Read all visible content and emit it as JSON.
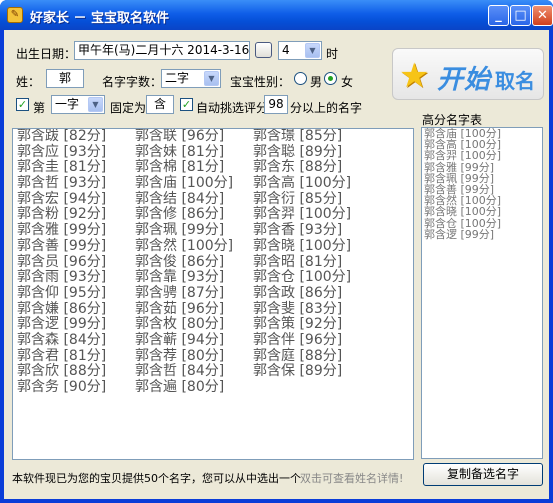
{
  "window": {
    "title": "好家长 － 宝宝取名软件"
  },
  "form": {
    "birth_label": "出生日期：",
    "birth_value": "甲午年(马)二月十六 2014-3-16",
    "hour_value": "4",
    "hour_unit": "时",
    "surname_label": "姓：",
    "surname_value": "郭",
    "name_length_label": "名字字数：",
    "name_length_value": "二字",
    "gender_label": "宝宝性别：",
    "gender_male": "男",
    "gender_female": "女",
    "position_prefix": "第",
    "position_value": "一字",
    "fixed_label": "固定为",
    "fixed_char": "含",
    "auto_label": "自动挑选评分",
    "score_value": "98",
    "score_suffix": "分以上的名字"
  },
  "start_button": {
    "main": "开始",
    "sub": "取名"
  },
  "name_columns": [
    [
      "郭含跋 [82分]",
      "郭含应 [93分]",
      "郭含圭 [81分]",
      "郭含哲 [93分]",
      "郭含宏 [94分]",
      "郭含粉 [92分]",
      "郭含雅 [99分]",
      "郭含善 [99分]",
      "郭含员 [96分]",
      "郭含雨 [93分]",
      "郭含仰 [95分]",
      "郭含嫌 [86分]",
      "郭含逻 [99分]",
      "郭含森 [84分]",
      "郭含君 [81分]",
      "郭含欣 [88分]",
      "郭含务 [90分]"
    ],
    [
      "郭含联 [96分]",
      "郭含妹 [81分]",
      "郭含棉 [81分]",
      "郭含庙 [100分]",
      "郭含结 [84分]",
      "郭含修 [86分]",
      "郭含珮 [99分]",
      "郭含然 [100分]",
      "郭含俊 [86分]",
      "郭含靠 [93分]",
      "郭含骋 [87分]",
      "郭含茹 [96分]",
      "郭含枚 [80分]",
      "郭含蕲 [94分]",
      "郭含荐 [80分]",
      "郭含哲 [84分]",
      "郭含遍 [80分]"
    ],
    [
      "郭含璟 [85分]",
      "郭含聪 [89分]",
      "郭含东 [88分]",
      "郭含高 [100分]",
      "郭含衍 [85分]",
      "郭含羿 [100分]",
      "郭含香 [93分]",
      "郭含晓 [100分]",
      "郭含昭 [81分]",
      "郭含仓 [100分]",
      "郭含政 [86分]",
      "郭含斐 [83分]",
      "郭含策 [92分]",
      "郭含伴 [96分]",
      "郭含庭 [88分]",
      "郭含保 [89分]"
    ]
  ],
  "side": {
    "title": "高分名字表",
    "items": [
      "郭含庙 [100分]",
      "郭含高 [100分]",
      "郭含羿 [100分]",
      "郭含雅 [99分]",
      "郭含珮 [99分]",
      "郭含善 [99分]",
      "郭含然 [100分]",
      "郭含晓 [100分]",
      "郭含仓 [100分]",
      "郭含逻 [99分]"
    ]
  },
  "status": {
    "text": "本软件现已为您的宝贝提供50个名字，您可以从中选出一个",
    "hint": "双击可查看姓名详情!"
  },
  "copy_button": "复制备选名字"
}
